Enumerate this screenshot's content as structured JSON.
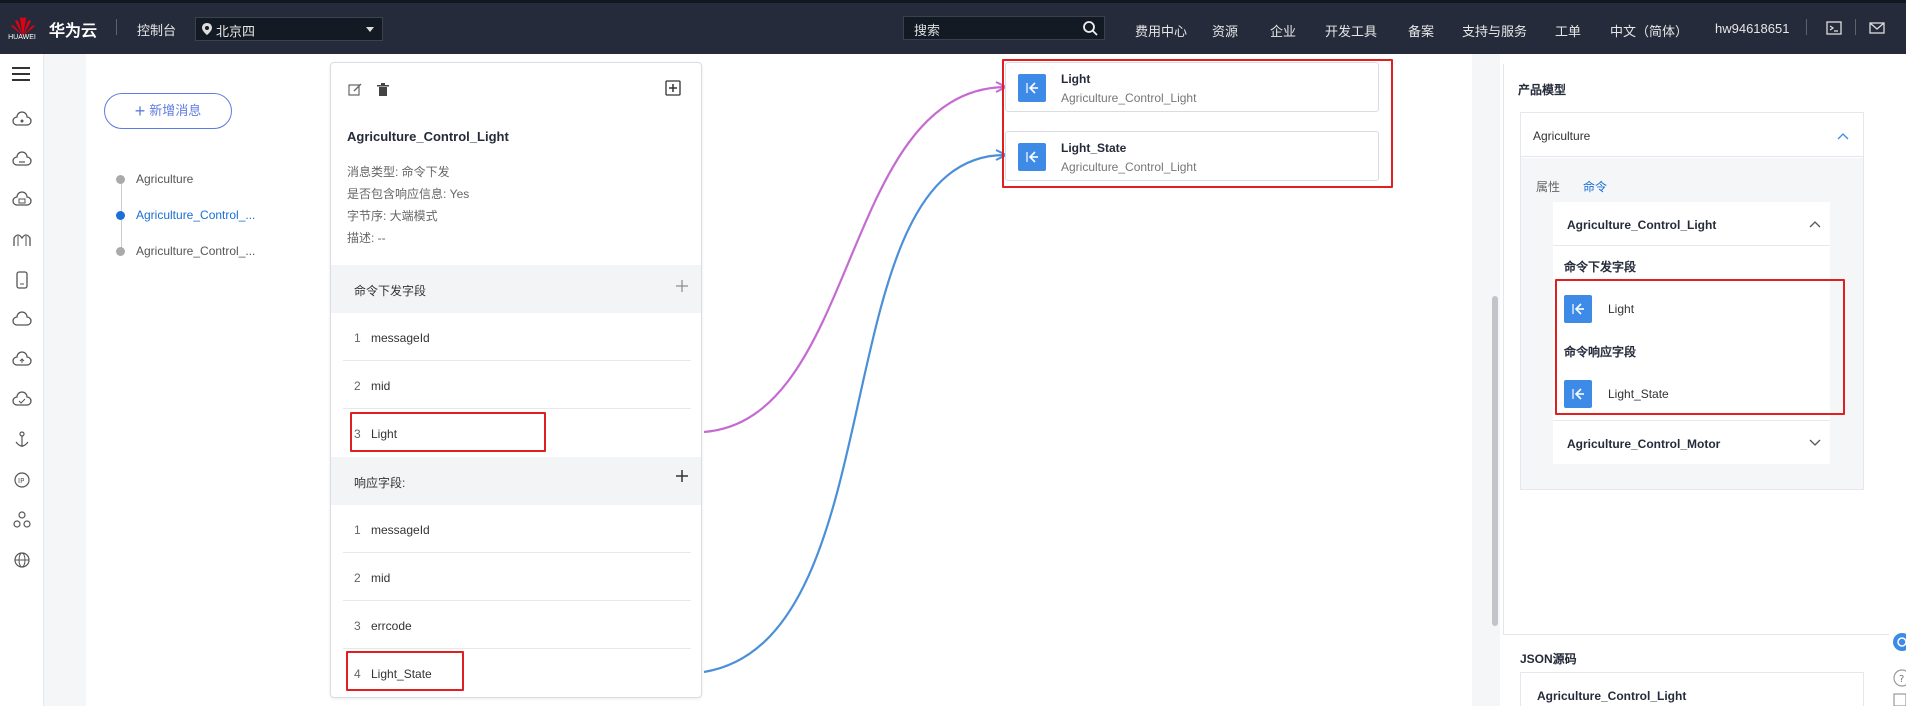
{
  "topbar": {
    "logo_text": "HUAWEI",
    "brand": "华为云",
    "console": "控制台",
    "region": "北京四",
    "search_placeholder": "搜索",
    "nav": [
      "费用中心",
      "资源",
      "企业",
      "开发工具",
      "备案",
      "支持与服务",
      "工单",
      "中文（简体）"
    ],
    "user": "hw94618651"
  },
  "left": {
    "new_button": "新增消息",
    "tree": [
      "Agriculture",
      "Agriculture_Control_...",
      "Agriculture_Control_..."
    ]
  },
  "card": {
    "title": "Agriculture_Control_Light",
    "meta": [
      "消息类型: 命令下发",
      "是否包含响应信息: Yes",
      "字节序: 大端模式",
      "描述: --"
    ],
    "cmd_section": "命令下发字段",
    "cmd_fields": [
      {
        "num": "1",
        "name": "messageId"
      },
      {
        "num": "2",
        "name": "mid"
      },
      {
        "num": "3",
        "name": "Light"
      }
    ],
    "resp_section": "响应字段:",
    "resp_fields": [
      {
        "num": "1",
        "name": "messageId"
      },
      {
        "num": "2",
        "name": "mid"
      },
      {
        "num": "3",
        "name": "errcode"
      },
      {
        "num": "4",
        "name": "Light_State"
      }
    ]
  },
  "props": [
    {
      "title": "Light",
      "sub": "Agriculture_Control_Light"
    },
    {
      "title": "Light_State",
      "sub": "Agriculture_Control_Light"
    }
  ],
  "right": {
    "title": "产品模型",
    "model": "Agriculture",
    "tabs": [
      "属性",
      "命令"
    ],
    "command": "Agriculture_Control_Light",
    "cmd_label": "命令下发字段",
    "cmd_field": "Light",
    "resp_label": "命令响应字段",
    "resp_field": "Light_State",
    "other_command": "Agriculture_Control_Motor",
    "json_title": "JSON源码",
    "json_content": "Agriculture_Control_Light"
  },
  "colors": {
    "topbar": "#252b3a",
    "accent": "#5e7ce0",
    "link": "#1a6ed6",
    "field_icon": "#3d8be6",
    "highlight": "#e02020",
    "curve_purple": "#c56ad1",
    "curve_blue": "#4a8fd8"
  }
}
